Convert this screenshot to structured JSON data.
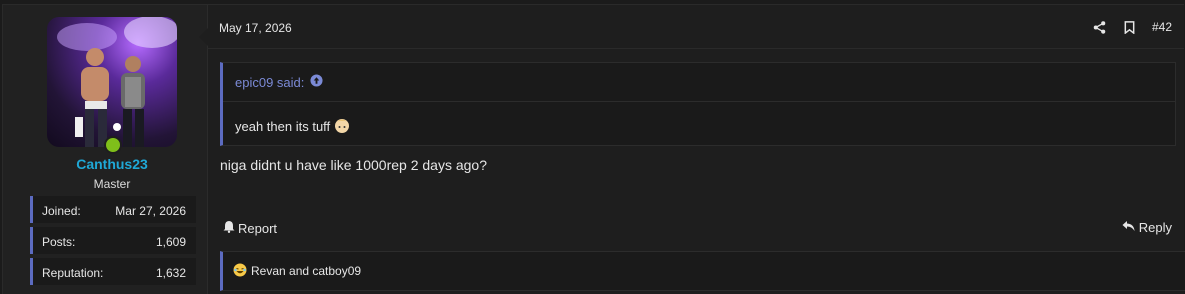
{
  "post": {
    "date": "May 17, 2026",
    "number": "#42",
    "message": "niga didnt u have like 1000rep 2 days ago?"
  },
  "author": {
    "username": "Canthus23",
    "title": "Master",
    "status_color": "#7fbf1a",
    "stats": [
      {
        "label": "Joined:",
        "value": "Mar 27, 2026"
      },
      {
        "label": "Posts:",
        "value": "1,609"
      },
      {
        "label": "Reputation:",
        "value": "1,632"
      }
    ]
  },
  "quote": {
    "attribution": "epic09 said:",
    "text": "yeah then its tuff"
  },
  "actions": {
    "report": "Report",
    "reply": "Reply"
  },
  "reactions": {
    "text": "Revan and catboy09"
  },
  "colors": {
    "accent": "#5c6bc0",
    "username": "#1fa8d6",
    "link": "#7b8ad6"
  }
}
